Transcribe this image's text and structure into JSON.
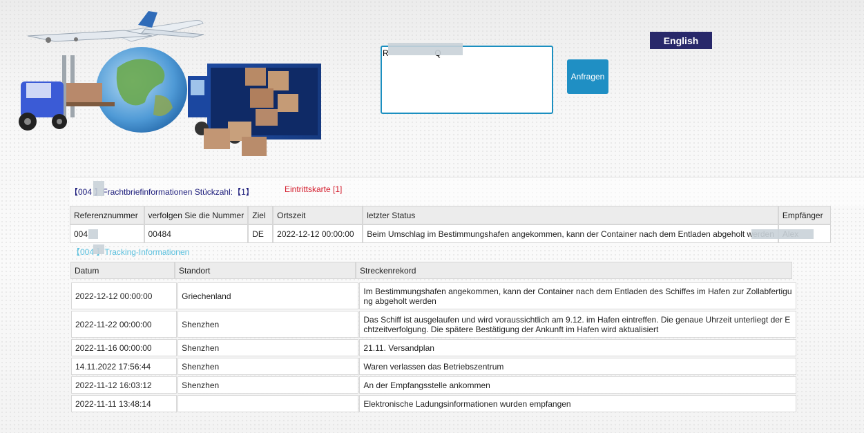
{
  "language_button": "English",
  "search": {
    "value": "R                    Q",
    "submit_label": "Anfragen"
  },
  "waybill": {
    "title": "【004   】Frachtbriefinformationen Stückzahl:【1】",
    "admission_link": "Eintrittskarte [1]"
  },
  "summary": {
    "headers": [
      "Referenznummer",
      "verfolgen Sie die Nummer",
      "Ziel",
      "Ortszeit",
      "letzter Status",
      "Empfänger"
    ],
    "row": [
      "004",
      "00484",
      "DE",
      "2022-12-12 00:00:00",
      "Beim Umschlag im Bestimmungshafen angekommen, kann der Container nach dem Entladen abgeholt werden",
      "Alex"
    ]
  },
  "tracking": {
    "heading": "【004   】Tracking-Informationen",
    "headers": [
      "Datum",
      "Standort",
      "Streckenrekord"
    ],
    "rows": [
      [
        "2022-12-12 00:00:00",
        "Griechenland",
        "Im Bestimmungshafen angekommen, kann der Container nach dem Entladen des Schiffes im Hafen zur Zollabfertigung abgeholt werden"
      ],
      [
        "2022-11-22 00:00:00",
        "Shenzhen",
        "Das Schiff ist ausgelaufen und wird voraussichtlich am 9.12. im Hafen eintreffen. Die genaue Uhrzeit unterliegt der Echtzeitverfolgung. Die spätere Bestätigung der Ankunft im Hafen wird aktualisiert"
      ],
      [
        "2022-11-16 00:00:00",
        "Shenzhen",
        "21.11. Versandplan"
      ],
      [
        "14.11.2022 17:56:44",
        "Shenzhen",
        "Waren verlassen das Betriebszentrum"
      ],
      [
        "2022-11-12 16:03:12",
        "Shenzhen",
        "An der Empfangsstelle ankommen"
      ],
      [
        "2022-11-11 13:48:14",
        "",
        "Elektronische Ladungsinformationen wurden empfangen"
      ]
    ]
  },
  "colors": {
    "accent": "#1f8fc4",
    "language_button": "#28286a",
    "admission_link": "#d41e2e",
    "tracking_heading": "#5bc0de"
  }
}
